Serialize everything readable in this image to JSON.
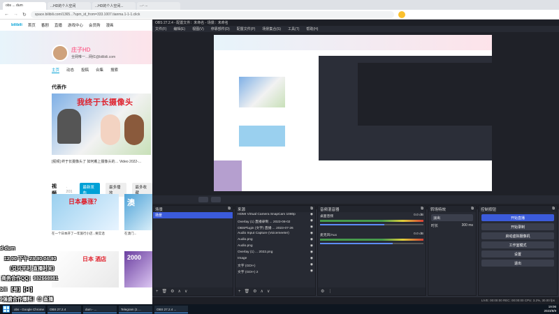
{
  "browser": {
    "tabs": [
      "obs ... dum",
      "...HD的个人空间",
      "...HD的个人空间...",
      "...- ..."
    ],
    "url": "space.bilibili.com/1365...?spm_id_from=333.1007.tianma.1-1-1.click"
  },
  "bili_nav": {
    "logo": "bilibili",
    "items": [
      "首页",
      "番剧",
      "直播",
      "游戏中心",
      "会员购",
      "漫画",
      "赛事",
      "下载客户端"
    ]
  },
  "profile": {
    "name": "庄子HD",
    "sign": "全网唯一…网红@bilibili.com",
    "tabs": [
      "主页",
      "动态",
      "投稿",
      "合集",
      "搜索"
    ],
    "featured_label": "代表作",
    "featured_caption": "我终于长摄像头",
    "featured_desc": "[视频] 终于长摄像头了 如何戴上摄像头的…  Video 2022-...",
    "videos_label": "视频",
    "videos_count": "· 201",
    "video_sorts": [
      "最新发布",
      "最多播放",
      "最多收藏"
    ],
    "videos": [
      {
        "title": "日本暴涨？",
        "caption": "在一个日本开了一年旅行小店...要实话"
      },
      {
        "title": "澳",
        "caption": "在澳门..."
      },
      {
        "title": "日本 酒店",
        "caption": "日本..."
      },
      {
        "title": "2000",
        "caption": "..."
      }
    ]
  },
  "overlay_lines": [
    "d-dum",
    "12:00-下午 23:30-04:30",
    "（只兴平时 直播时间）",
    "商务合作QQ：932668981",
    "bili 【号】【Hi】",
    "9强盛合作爆料！😊 直播"
  ],
  "obs": {
    "title": "OBS 27.2.4 - 配置文件：未命名 - 场景：未命名",
    "menu": [
      "文件(F)",
      "编辑(E)",
      "视图(V)",
      "停靠部件(D)",
      "配置文件(P)",
      "场景集合(S)",
      "工具(T)",
      "帮助(H)"
    ],
    "docks": {
      "scenes": {
        "title": "场景",
        "items": [
          "场景"
        ]
      },
      "sources": {
        "title": "来源",
        "items": [
          "HDMI Virtual Camera SnapCam 1080p",
          "Overlay (1) 直播录制 ... 2023-08-02",
          "OBSPlugin (文字) 直播 ... 2023-07-26",
          "Audio Input Capture (Voicemeeter)",
          "Audio.png",
          "Audio.png",
          "Overlay (1) ... 2022.png",
          "Image",
          "文字 (GDI+)",
          "文字 (GDI+) 2"
        ]
      },
      "mixer": {
        "title": "音频混音器",
        "channels": [
          {
            "name": "桌面音频",
            "db": "0.0 dB",
            "level": 0.62
          },
          {
            "name": "麦克风/Aux",
            "db": "0.0 dB",
            "level": 0.7
          }
        ]
      },
      "transitions": {
        "title": "转场特效",
        "type": "淡出",
        "duration_label": "时长",
        "duration": "300 ms"
      },
      "controls": {
        "title": "控制按钮",
        "buttons": [
          "开始直播",
          "开始录制",
          "启动虚拟摄像机",
          "工作室模式",
          "设置",
          "退出"
        ]
      }
    },
    "status": "LIVE: 00:00:00  REC: 00:00:00  CPU: 3.2%, 30.00 fps"
  },
  "taskbar": {
    "items": [
      "obs - Google Chrome",
      "OBS 27.2.4",
      "dum - ...",
      "Telegram (1 ...",
      "OBS 27.2.4 ..."
    ],
    "time": "19:06",
    "date": "2023/8/9"
  }
}
